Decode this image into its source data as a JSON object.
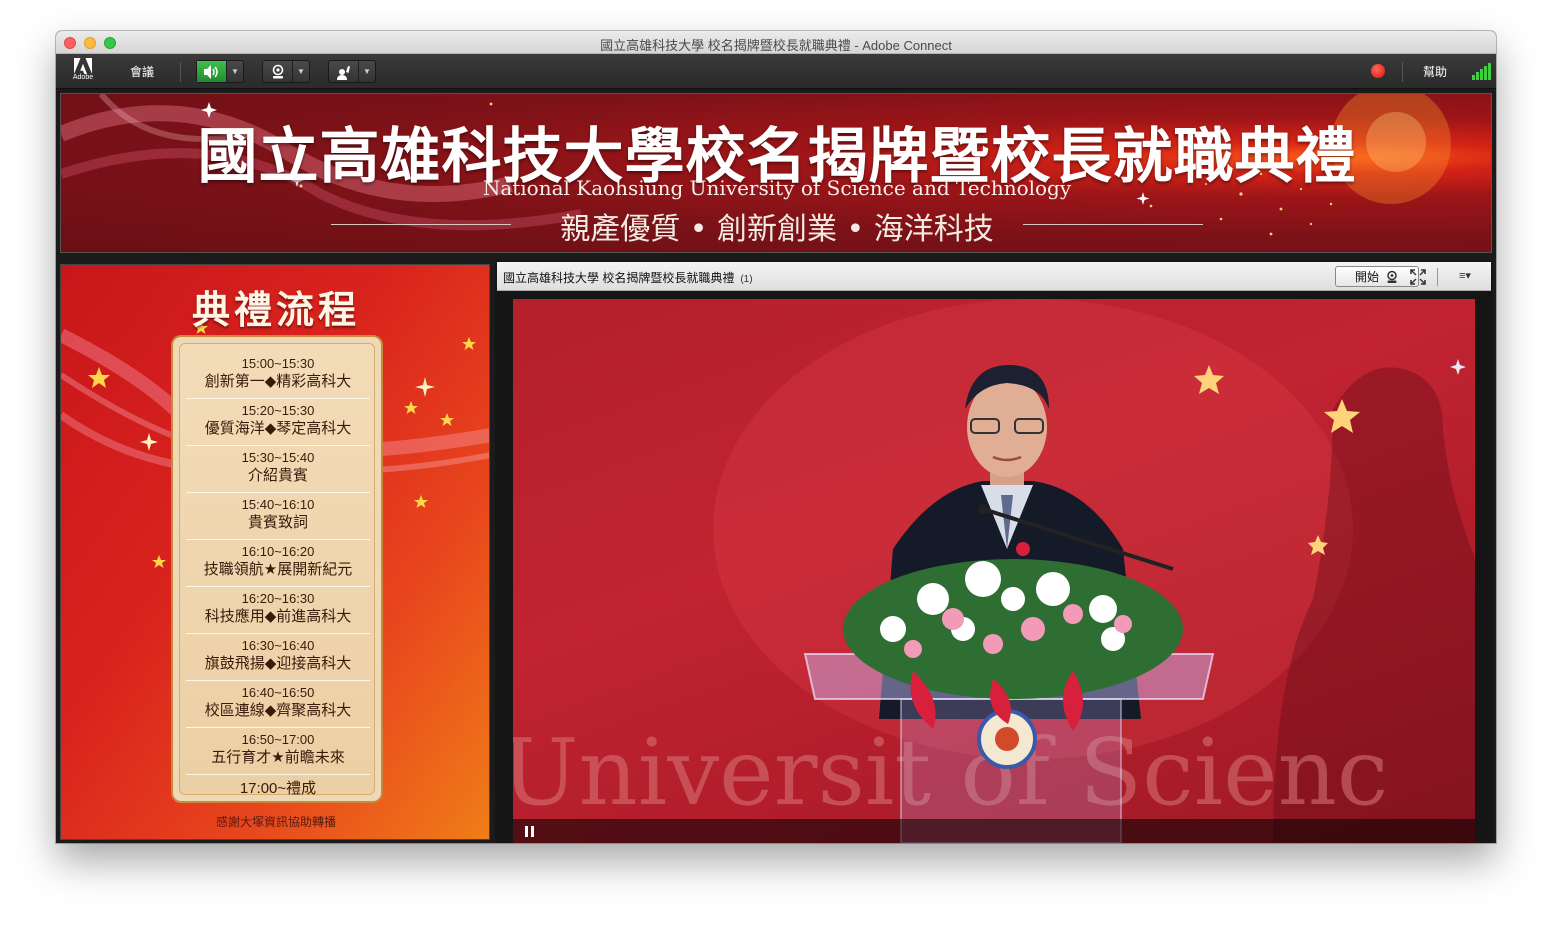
{
  "window": {
    "title": "國立高雄科技大學 校名揭牌暨校長就職典禮 - Adobe Connect"
  },
  "menubar": {
    "logo_label": "Adobe",
    "meeting_menu": "會議",
    "help_menu": "幫助",
    "icons": [
      "speaker-icon",
      "webcam-icon",
      "raise-hand-icon",
      "record-icon",
      "connection-signal-icon"
    ],
    "speaker_active_color": "#2fa13a",
    "record_color": "#e0160c"
  },
  "banner": {
    "title": "國立高雄科技大學校名揭牌暨校長就職典禮",
    "subtitle": "National Kaohsiung University of Science and Technology",
    "motto": "親產優質 • 創新創業 • 海洋科技"
  },
  "program": {
    "title": "典禮流程",
    "items": [
      {
        "time": "15:00~15:30",
        "name": "創新第一◆精彩高科大"
      },
      {
        "time": "15:20~15:30",
        "name": "優質海洋◆琴定高科大"
      },
      {
        "time": "15:30~15:40",
        "name": "介紹貴賓"
      },
      {
        "time": "15:40~16:10",
        "name": "貴賓致詞"
      },
      {
        "time": "16:10~16:20",
        "name": "技職領航★展開新紀元"
      },
      {
        "time": "16:20~16:30",
        "name": "科技應用◆前進高科大"
      },
      {
        "time": "16:30~16:40",
        "name": "旗鼓飛揚◆迎接高科大"
      },
      {
        "time": "16:40~16:50",
        "name": "校區連線◆齊聚高科大"
      },
      {
        "time": "16:50~17:00",
        "name": "五行育才★前瞻未來"
      },
      {
        "time": "17:00~禮成",
        "name": ""
      }
    ],
    "footnote": "感謝大塚資訊協助轉播"
  },
  "video_pod": {
    "title": "國立高雄科技大學 校名揭牌暨校長就職典禮",
    "count": "(1)",
    "start_button": "開始",
    "menu_glyph": "≡▾",
    "backdrop_text": "Universit   of Scienc"
  }
}
